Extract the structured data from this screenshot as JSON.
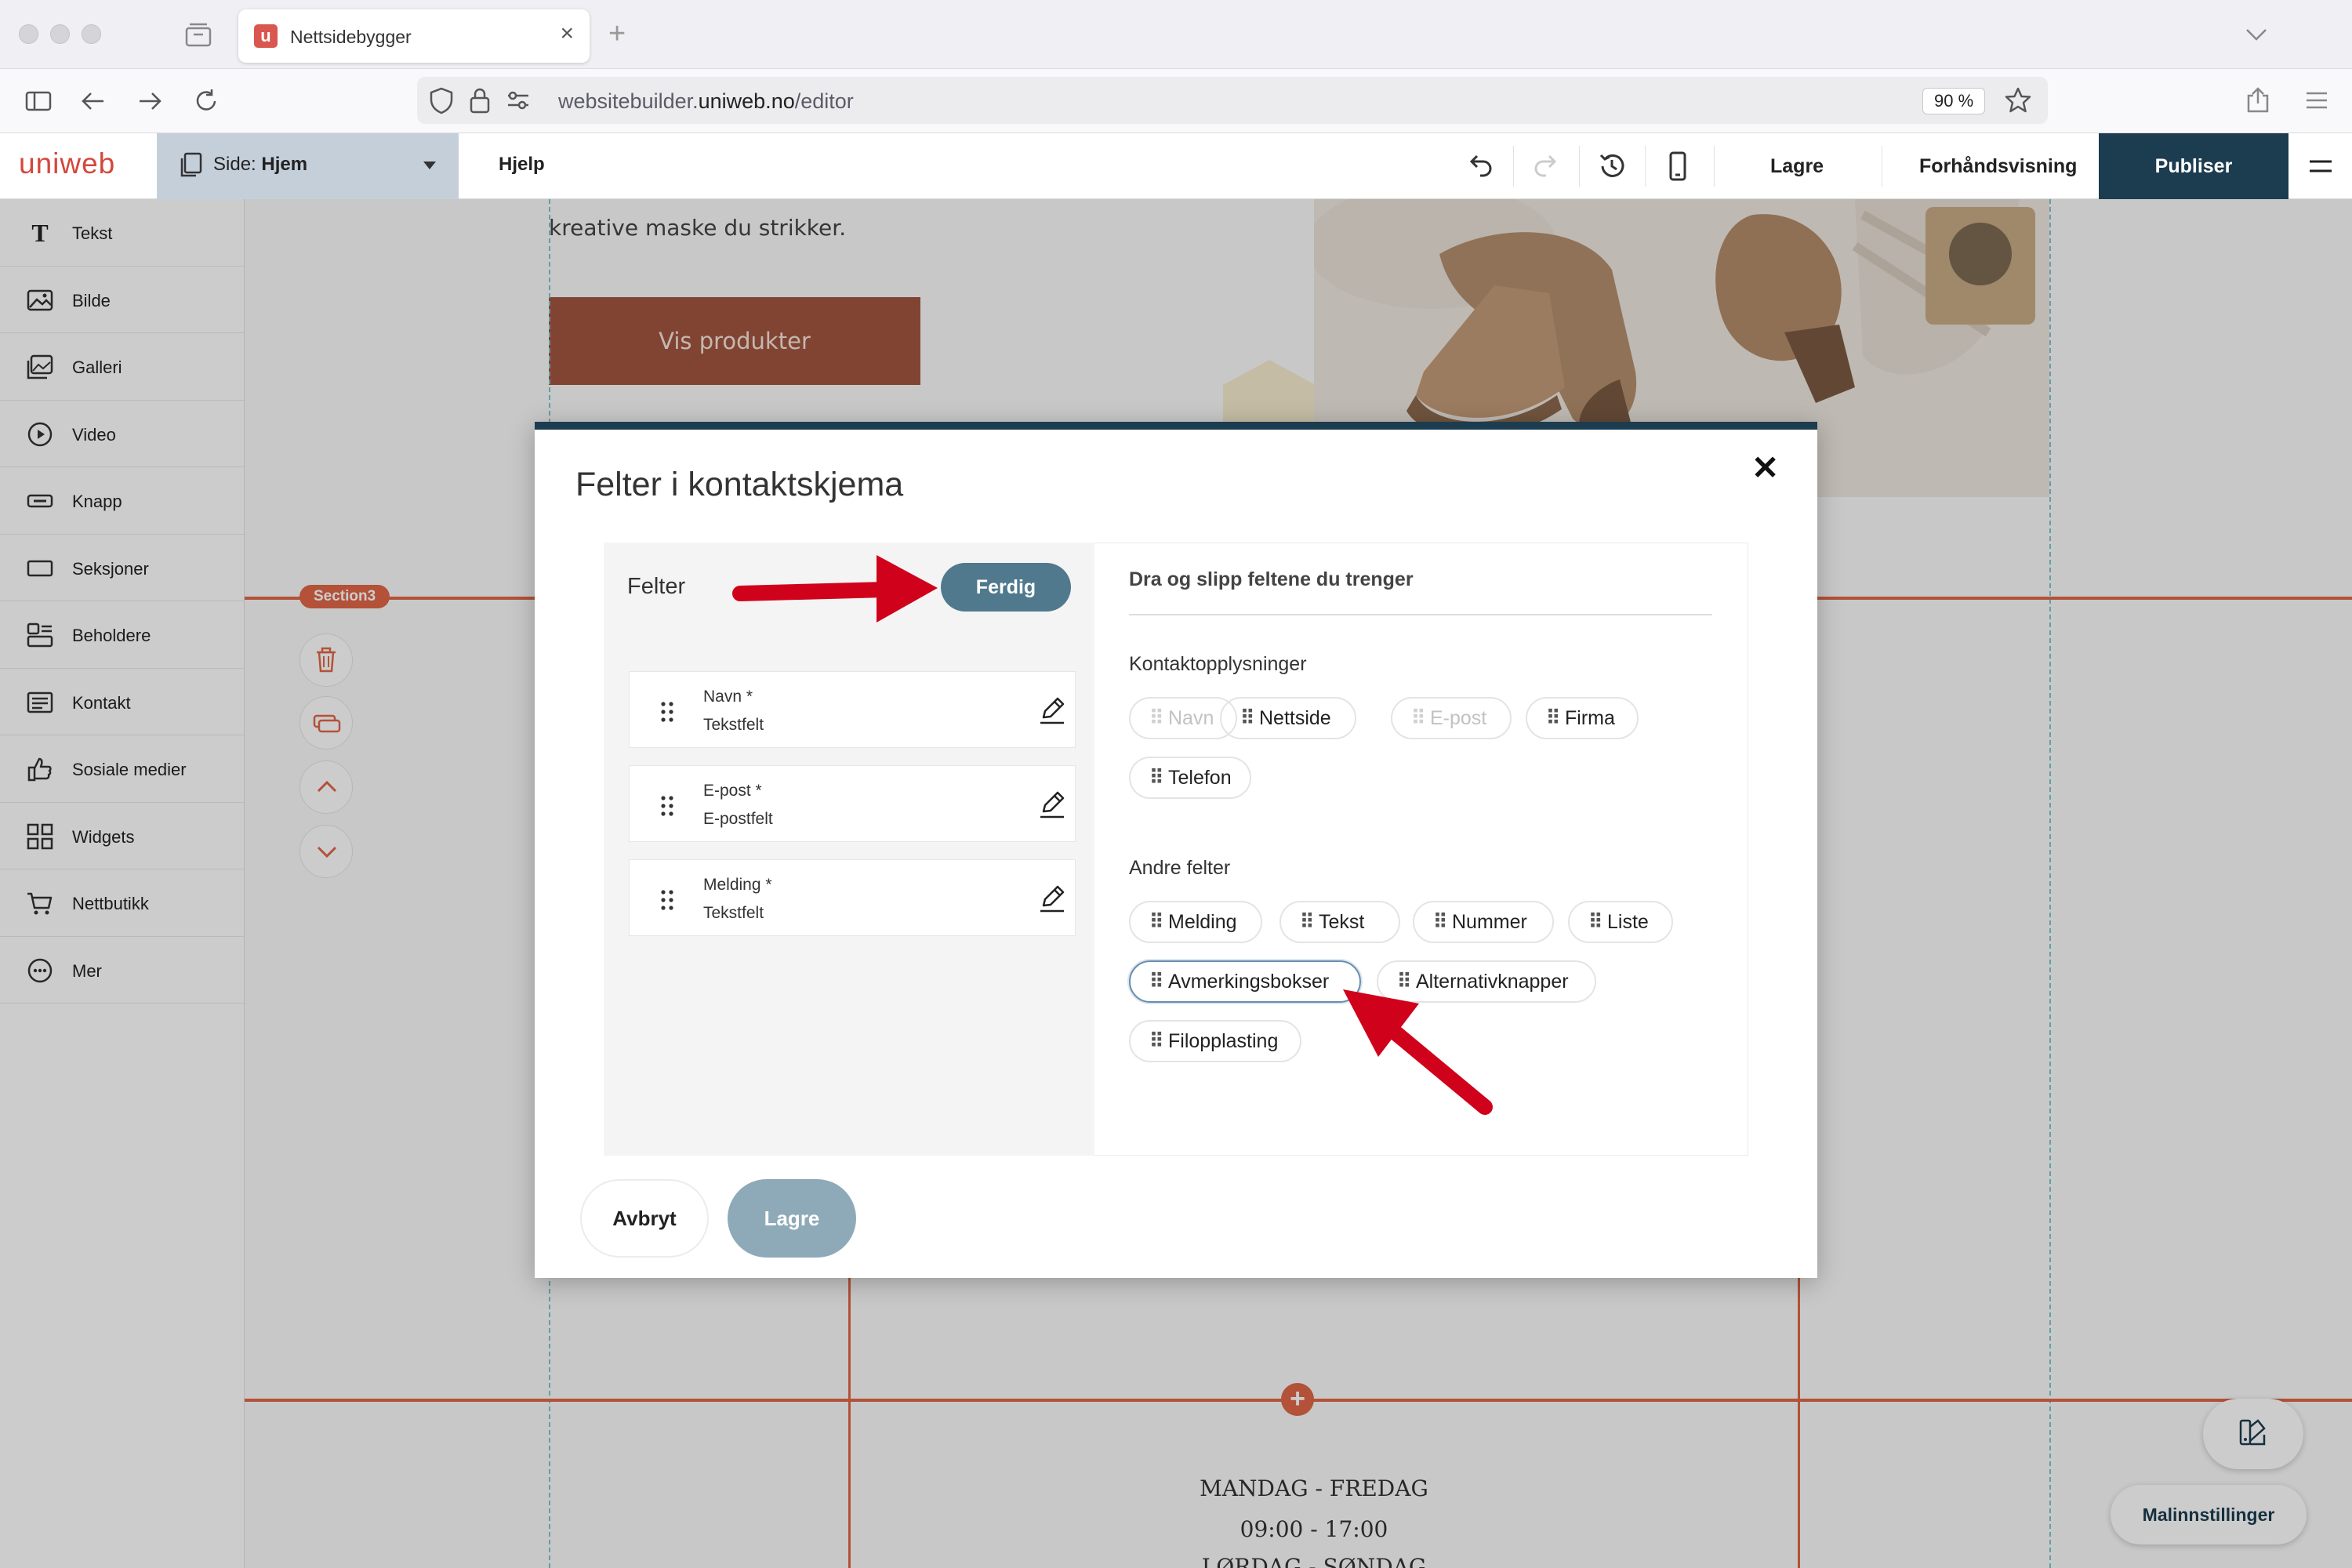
{
  "browser": {
    "tab_title": "Nettsidebygger",
    "url_prefix": "websitebuilder.",
    "url_domain": "uniweb.no",
    "url_path": "/editor",
    "zoom": "90 %"
  },
  "app": {
    "logo": "uniweb",
    "page_label": "Side:",
    "page_name": "Hjem",
    "help": "Hjelp",
    "save": "Lagre",
    "preview": "Forhåndsvisning",
    "publish": "Publiser"
  },
  "sidebar": {
    "items": [
      {
        "label": "Tekst",
        "icon": "text-icon"
      },
      {
        "label": "Bilde",
        "icon": "image-icon"
      },
      {
        "label": "Galleri",
        "icon": "gallery-icon"
      },
      {
        "label": "Video",
        "icon": "video-icon"
      },
      {
        "label": "Knapp",
        "icon": "button-icon"
      },
      {
        "label": "Seksjoner",
        "icon": "sections-icon"
      },
      {
        "label": "Beholdere",
        "icon": "containers-icon"
      },
      {
        "label": "Kontakt",
        "icon": "contact-icon"
      },
      {
        "label": "Sosiale medier",
        "icon": "thumbs-up-icon"
      },
      {
        "label": "Widgets",
        "icon": "widgets-icon"
      },
      {
        "label": "Nettbutikk",
        "icon": "cart-icon"
      },
      {
        "label": "Mer",
        "icon": "more-icon"
      }
    ]
  },
  "canvas": {
    "hero_text": "kreative maske du strikker.",
    "hero_button": "Vis produkter",
    "section_tag": "Section3",
    "hours_line1": "MANDAG - FREDAG",
    "hours_line2": "09:00 - 17:00",
    "hours_line3": "LØRDAG - SØNDAG",
    "template_settings": "Malinnstillinger"
  },
  "modal": {
    "title": "Felter i kontaktskjema",
    "fields_header": "Felter",
    "done_button": "Ferdig",
    "fields": [
      {
        "name": "Navn *",
        "type": "Tekstfelt"
      },
      {
        "name": "E-post *",
        "type": "E-postfelt"
      },
      {
        "name": "Melding *",
        "type": "Tekstfelt"
      }
    ],
    "drag_header": "Dra og slipp feltene du trenger",
    "contact_section": "Kontaktopplysninger",
    "contact_fields": [
      {
        "label": "Navn",
        "state": "disabled"
      },
      {
        "label": "Nettside",
        "state": "normal"
      },
      {
        "label": "E-post",
        "state": "disabled"
      },
      {
        "label": "Firma",
        "state": "normal"
      },
      {
        "label": "Telefon",
        "state": "normal"
      }
    ],
    "other_section": "Andre felter",
    "other_fields": [
      {
        "label": "Melding",
        "state": "normal"
      },
      {
        "label": "Tekst",
        "state": "normal"
      },
      {
        "label": "Nummer",
        "state": "normal"
      },
      {
        "label": "Liste",
        "state": "normal"
      },
      {
        "label": "Avmerkingsbokser",
        "state": "highlighted"
      },
      {
        "label": "Alternativknapper",
        "state": "normal"
      },
      {
        "label": "Filopplasting",
        "state": "normal"
      }
    ],
    "cancel": "Avbryt",
    "save": "Lagre"
  },
  "colors": {
    "primary_dark": "#1c3c4f",
    "accent_red": "#e06648",
    "brand_red": "#d4473c",
    "done_button": "#50798e",
    "save_disabled": "#8eaab8",
    "annotation_arrow": "#d0021b"
  }
}
